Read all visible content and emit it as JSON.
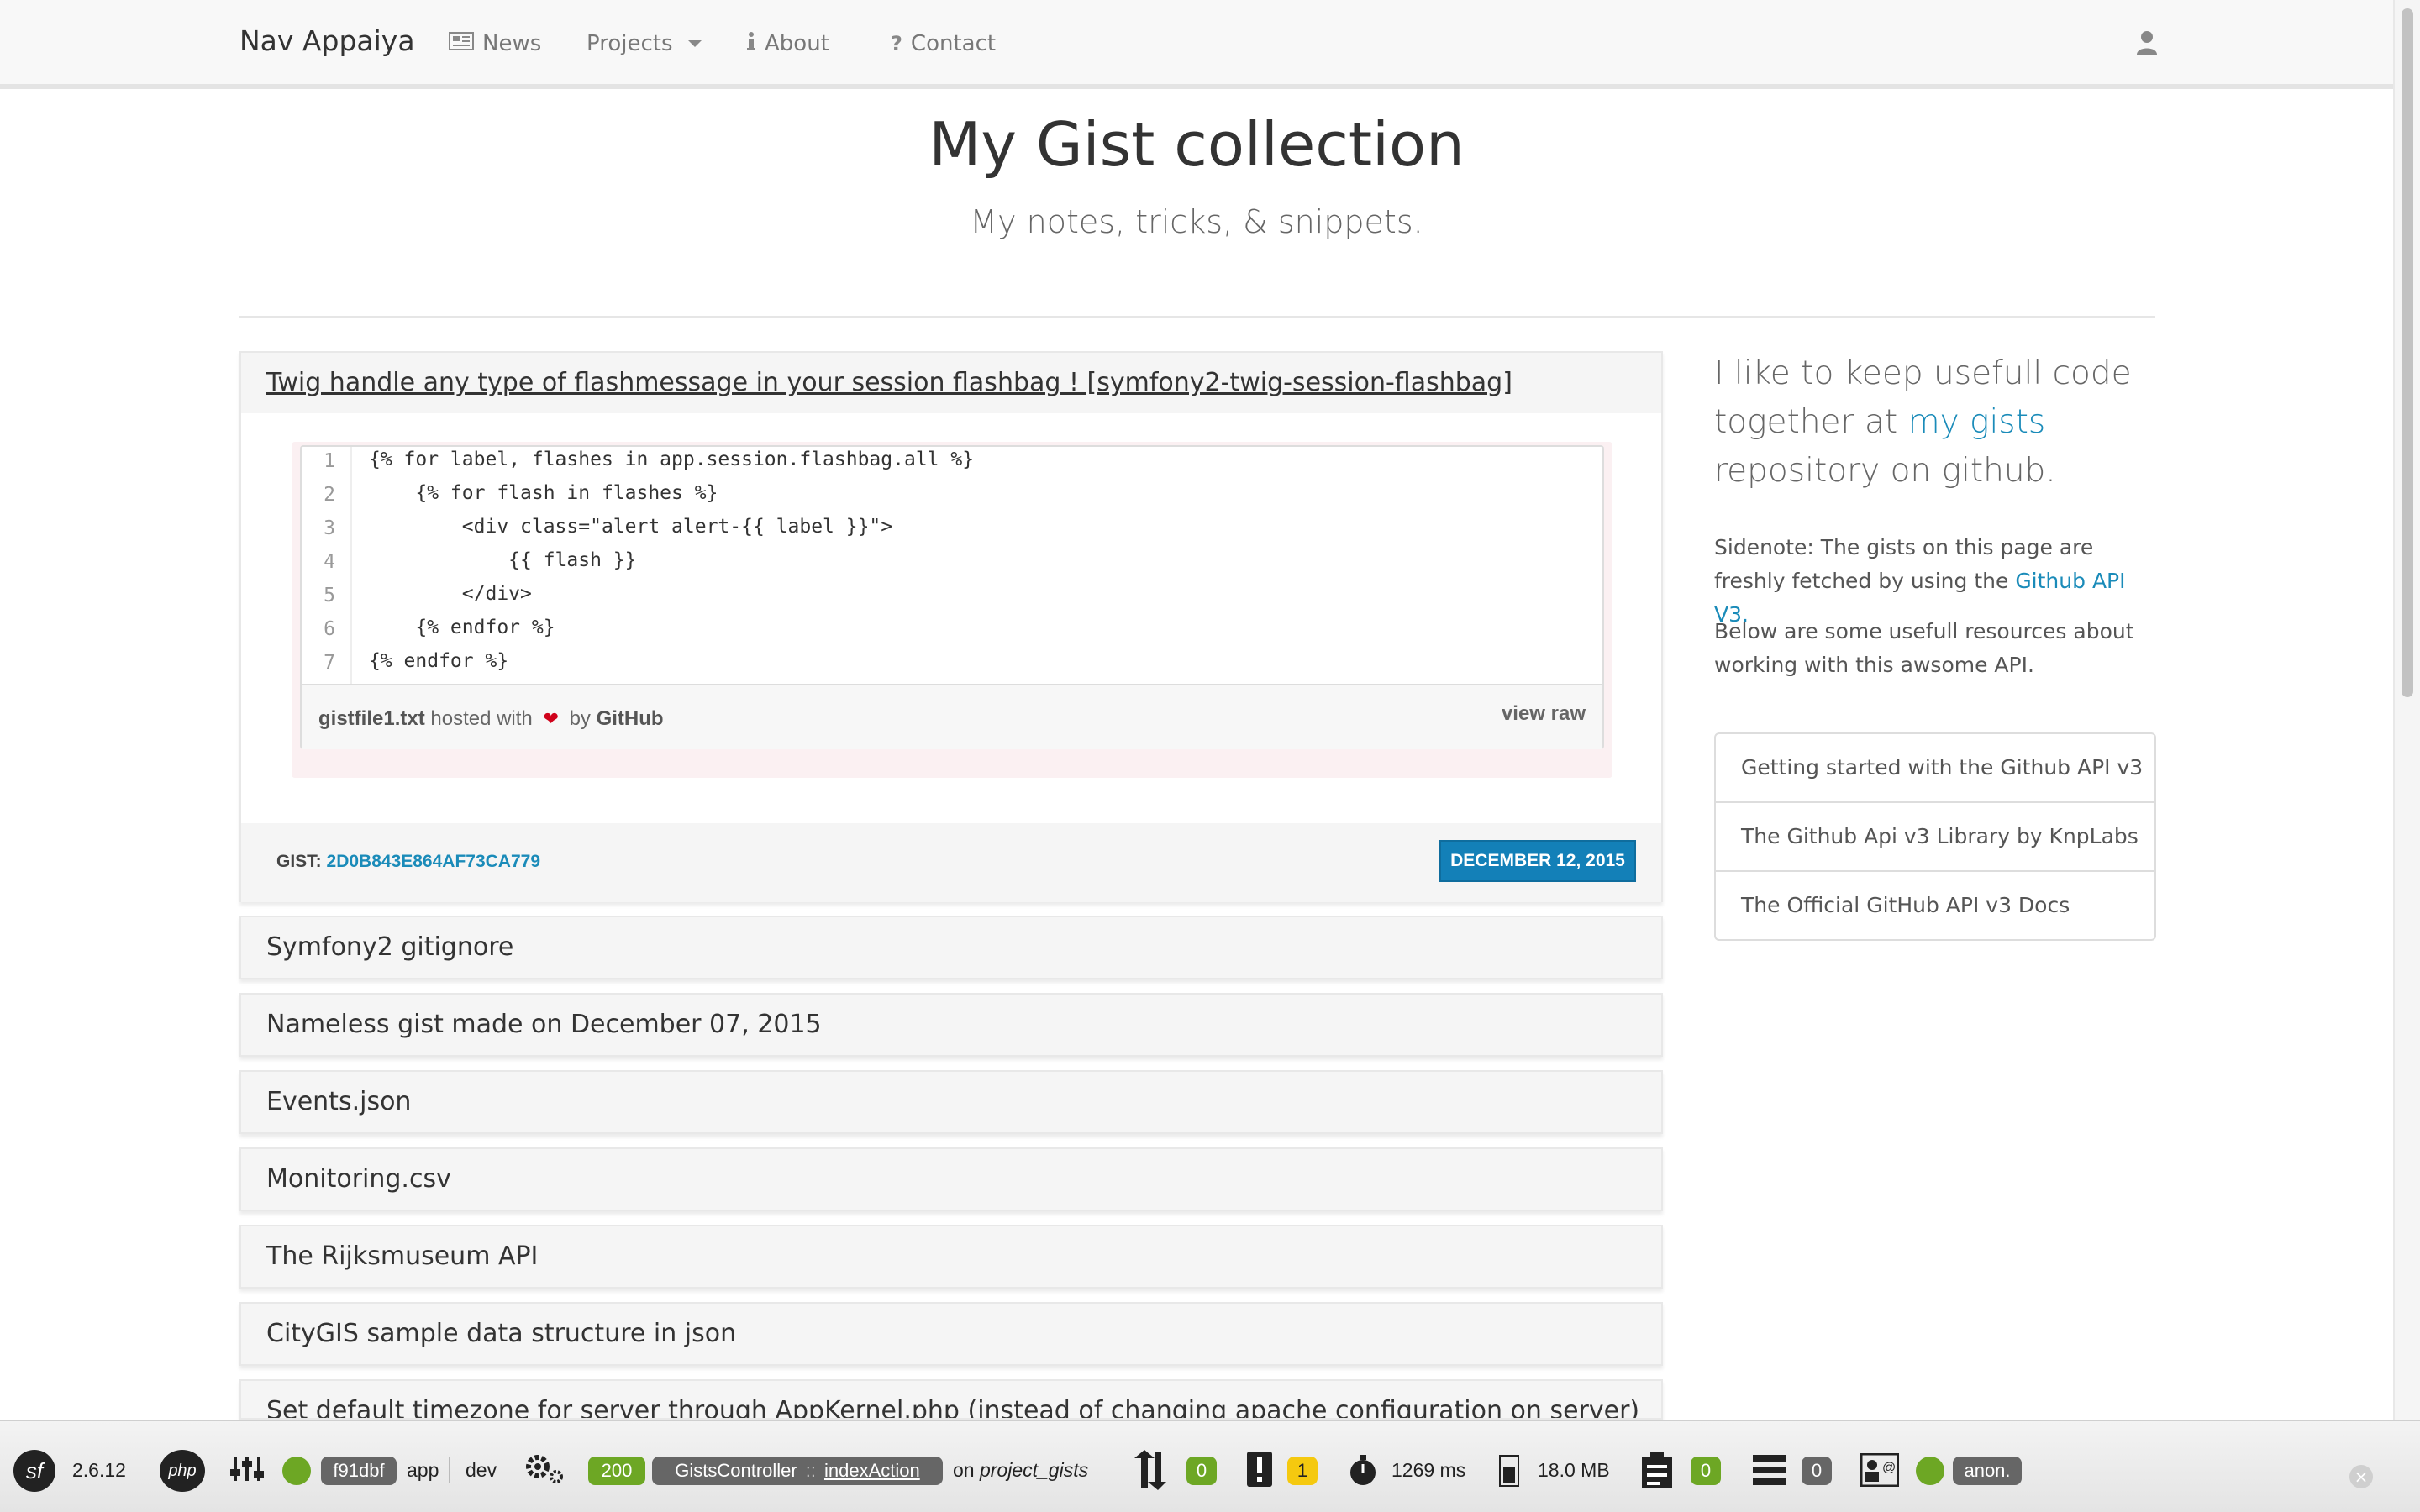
{
  "nav": {
    "brand": "Nav Appaiya",
    "items": [
      {
        "label": "News",
        "icon": "newspaper-icon"
      },
      {
        "label": "Projects",
        "icon": "",
        "dropdown": true
      },
      {
        "label": "About",
        "icon": "info-icon"
      },
      {
        "label": "Contact",
        "icon": "question-icon"
      }
    ],
    "user_icon": "user-icon"
  },
  "header": {
    "title": "My Gist collection",
    "subtitle": "My notes, tricks, & snippets."
  },
  "gists": {
    "open": {
      "title": "Twig handle any type of flashmessage in your session flashbag ! [symfony2-twig-session-flashbag]",
      "code_lines": [
        "{% for label, flashes in app.session.flashbag.all %}",
        "    {% for flash in flashes %}",
        "        <div class=\"alert alert-{{ label }}\">",
        "            {{ flash }}",
        "        </div>",
        "    {% endfor %}",
        "{% endfor %}"
      ],
      "line_numbers": [
        "1",
        "2",
        "3",
        "4",
        "5",
        "6",
        "7"
      ],
      "filename": "gistfile1.txt",
      "hosted_with": "hosted with",
      "by": "by",
      "host": "GitHub",
      "view_raw": "view raw",
      "gist_label": "GIST:",
      "gist_id": "2D0B843E864AF73CA779",
      "date": "DECEMBER 12, 2015"
    },
    "list": [
      "Symfony2 gitignore",
      "Nameless gist made on December 07, 2015",
      "Events.json",
      "Monitoring.csv",
      "The Rijksmuseum API",
      "CityGIS sample data structure in json",
      "Set default timezone for server through AppKernel.php (instead of changing apache configuration on server)"
    ]
  },
  "sidebar": {
    "lead_pre": "I like to keep usefull code together at ",
    "lead_link": "my gists",
    "lead_post": " repository on github.",
    "note1_pre": "Sidenote: The gists on this page are freshly fetched by using the ",
    "note1_link": "Github API V3.",
    "note2": "Below are some usefull resources about working with this awsome API.",
    "resources": [
      "Getting started with the Github API v3",
      "The Github Api v3 Library by KnpLabs",
      "The Official GitHub API v3 Docs"
    ]
  },
  "toolbar": {
    "sf_logo": "sf",
    "version": "2.6.12",
    "php_logo": "php",
    "token": "f91dbf",
    "app": "app",
    "env": "dev",
    "status": "200",
    "controller": "GistsController",
    "controller_sep": "::",
    "action": "indexAction",
    "route_prefix": "on",
    "route": "project_gists",
    "ajax_count": "0",
    "errors_count": "1",
    "time": "1269 ms",
    "memory": "18.0 MB",
    "forms_count": "0",
    "db_count": "0",
    "user": "anon.",
    "close": "×"
  },
  "colors": {
    "link": "#1a8bb9",
    "badge": "#1380b8",
    "toolbar_green": "#6da724",
    "toolbar_yellow": "#f5c90f"
  }
}
